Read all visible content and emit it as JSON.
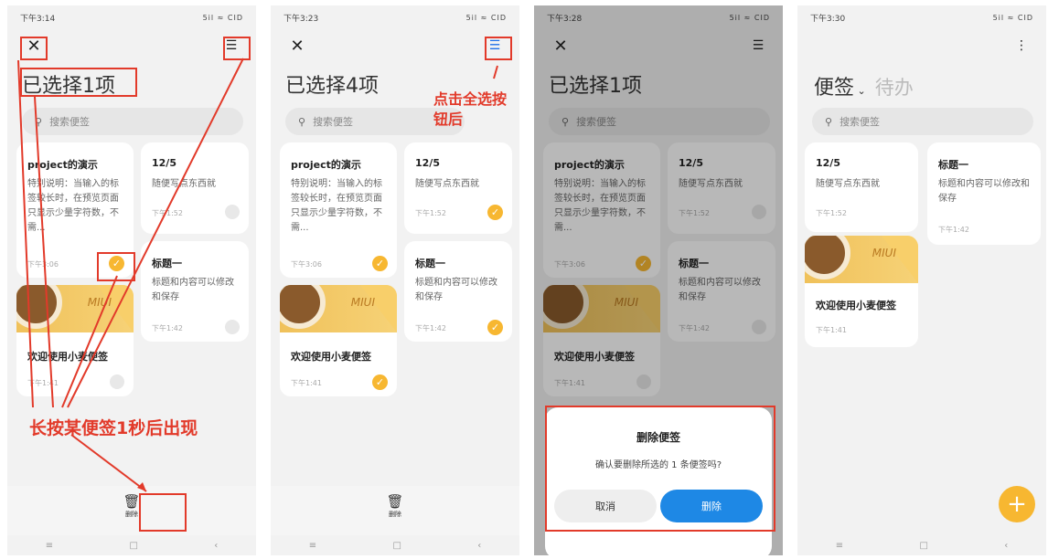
{
  "screens": [
    {
      "status": {
        "time": "下午3:14",
        "signal": "5il ≈ CID"
      },
      "title": "已选择1项",
      "search_placeholder": "搜索便签",
      "notes": [
        {
          "title": "project的演示",
          "body": "特别说明：当输入的标签较长时，在预览页面只显示少量字符数，不需...",
          "time": "下午3:06",
          "checked": true
        },
        {
          "title": "12/5",
          "body": "随便写点东西就",
          "time": "下午1:52",
          "checked": false
        },
        {
          "title": "标题一",
          "body": "标题和内容可以修改和保存",
          "time": "下午1:42",
          "checked": false
        },
        {
          "title": "欢迎使用小麦便签",
          "body": "",
          "time": "下午1:41",
          "checked": false
        }
      ],
      "delete_label": "删除",
      "annotation": "长按某便签1秒后出现"
    },
    {
      "status": {
        "time": "下午3:23",
        "signal": "5il ≈ CID"
      },
      "title": "已选择4项",
      "search_placeholder": "搜索便签",
      "notes": [
        {
          "title": "project的演示",
          "body": "特别说明：当输入的标签较长时，在预览页面只显示少量字符数，不需...",
          "time": "下午3:06",
          "checked": true
        },
        {
          "title": "12/5",
          "body": "随便写点东西就",
          "time": "下午1:52",
          "checked": true
        },
        {
          "title": "标题一",
          "body": "标题和内容可以修改和保存",
          "time": "下午1:42",
          "checked": true
        },
        {
          "title": "欢迎使用小麦便签",
          "body": "",
          "time": "下午1:41",
          "checked": true
        }
      ],
      "delete_label": "删除",
      "annotation_line1": "点击全选按",
      "annotation_line2": "钮后"
    },
    {
      "status": {
        "time": "下午3:28",
        "signal": "5il ≈ CID"
      },
      "title": "已选择1项",
      "search_placeholder": "搜索便签",
      "notes": [
        {
          "title": "project的演示",
          "body": "特别说明：当输入的标签较长时，在预览页面只显示少量字符数，不需...",
          "time": "下午3:06",
          "checked": true
        },
        {
          "title": "12/5",
          "body": "随便写点东西就",
          "time": "下午1:52",
          "checked": false
        },
        {
          "title": "标题一",
          "body": "标题和内容可以修改和保存",
          "time": "下午1:42",
          "checked": false
        },
        {
          "title": "欢迎使用小麦便签",
          "body": "",
          "time": "下午1:41",
          "checked": false
        }
      ],
      "dialog": {
        "title": "删除便签",
        "message": "确认要删除所选的 1 条便签吗?",
        "cancel": "取消",
        "confirm": "删除"
      }
    },
    {
      "status": {
        "time": "下午3:30",
        "signal": "5il ≈ CID"
      },
      "tab_notes": "便签",
      "tab_todo": "待办",
      "search_placeholder": "搜索便签",
      "notes": [
        {
          "title": "12/5",
          "body": "随便写点东西就",
          "time": "下午1:52"
        },
        {
          "title": "标题一",
          "body": "标题和内容可以修改和保存",
          "time": "下午1:42"
        },
        {
          "title": "欢迎使用小麦便签",
          "body": "",
          "time": "下午1:41"
        }
      ],
      "fab": "+"
    }
  ],
  "image_banner_logo": "MIUI",
  "colors": {
    "accent": "#f7b731",
    "annotation": "#e23a2a",
    "confirm": "#1e88e5"
  },
  "icons": {
    "close": "close-icon",
    "select_all": "select-all-icon",
    "trash": "trash-icon",
    "more": "more-icon",
    "search": "search-icon"
  }
}
